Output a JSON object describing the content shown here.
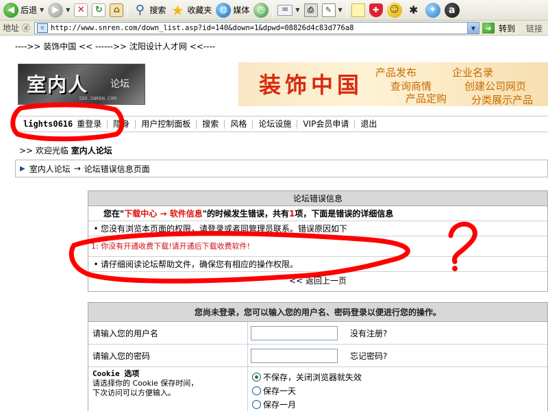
{
  "toolbar": {
    "back_label": "后退",
    "search_label": "搜索",
    "favorites_label": "收藏夹",
    "media_label": "媒体"
  },
  "address": {
    "label": "地址 ⓓ",
    "url": "http://www.snren.com/down_list.asp?id=140&down=1&dpwd=08826d4c83d776a8",
    "go_label": "转到",
    "links_label": "链接"
  },
  "page": {
    "top_breadcrumb": "---->> 装饰中国 << ------>> 沈阳设计人才网 <<----",
    "logo_main": "室内人",
    "logo_sub": "论坛",
    "logo_url": "IDO.SNREN.COM",
    "banner_main": "装饰中国",
    "banner_tags": [
      "产品发布",
      "企业名录",
      "查询商情",
      "创建公司网页",
      "产品定购",
      "分类展示产品"
    ],
    "nav": {
      "user": "lights0616",
      "items": [
        "重登录",
        "隐身",
        "用户控制面板",
        "搜索",
        "风格",
        "论坛设施",
        "VIP会员申请",
        "退出"
      ]
    },
    "welcome_prefix": ">> 欢迎光临",
    "welcome_site": "室内人论坛",
    "crumb": {
      "home": "室内人论坛",
      "arrow": "→",
      "current": "论坛错误信息页面"
    }
  },
  "error": {
    "header": "论坛错误信息",
    "title_pre": "您在\"",
    "title_loc1": "下载中心",
    "title_arrow": " → ",
    "title_loc2": "软件信息",
    "title_mid": "\"的时候发生错误，共有",
    "title_count": "1",
    "title_post": "项，下面是错误的详细信息",
    "line1": "您没有浏览本页面的权限，请登录或者同管理员联系。错误原因如下",
    "detail": "1: 你没有开通收费下载!请开通后下载收费软件!",
    "line2": "请仔细阅读论坛帮助文件，确保您有相应的操作权限。",
    "back": "<< 返回上一页"
  },
  "login": {
    "header": "您尚未登录，您可以输入您的用户名、密码登录以便进行您的操作。",
    "username_label": "请输入您的用户名",
    "register_link": "没有注册?",
    "password_label": "请输入您的密码",
    "forgot_link": "忘记密码?",
    "cookie_title": "Cookie 选项",
    "cookie_desc1": "请选择你的 Cookie 保存时间，",
    "cookie_desc2": "下次访问可以方便输入。",
    "options": [
      "不保存，关闭浏览器就失效",
      "保存一天",
      "保存一月"
    ],
    "selected_option": 0
  },
  "annotation": {
    "question_mark": "?",
    "color": "#ff0000"
  }
}
